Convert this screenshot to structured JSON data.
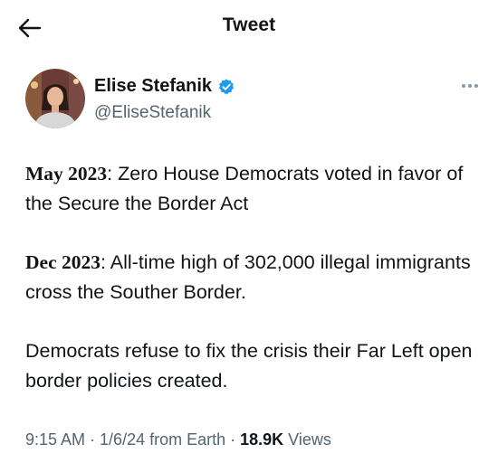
{
  "header": {
    "title": "Tweet",
    "back_icon": "arrow-left-icon"
  },
  "author": {
    "display_name": "Elise Stefanik",
    "handle": "@EliseStefanik",
    "verified_icon": "verified-badge-icon",
    "verified_color": "#1d9bf0"
  },
  "tweet": {
    "p1": {
      "date": "May 2023",
      "text": ": Zero House Democrats voted in favor of the Secure the Border Act"
    },
    "p2": {
      "date": "Dec 2023",
      "text": ": All-time high of 302,000 illegal immigrants cross the Souther Border."
    },
    "p3": {
      "text": "Democrats refuse to fix the crisis their Far Left open border policies created."
    }
  },
  "meta": {
    "time": "9:15 AM",
    "sep1": " · ",
    "date": "1/6/24 from Earth",
    "sep2": " · ",
    "views_count": "18.9K",
    "views_label": " Views"
  },
  "colors": {
    "text": "#0f1419",
    "secondary": "#536471",
    "accent": "#1d9bf0"
  }
}
